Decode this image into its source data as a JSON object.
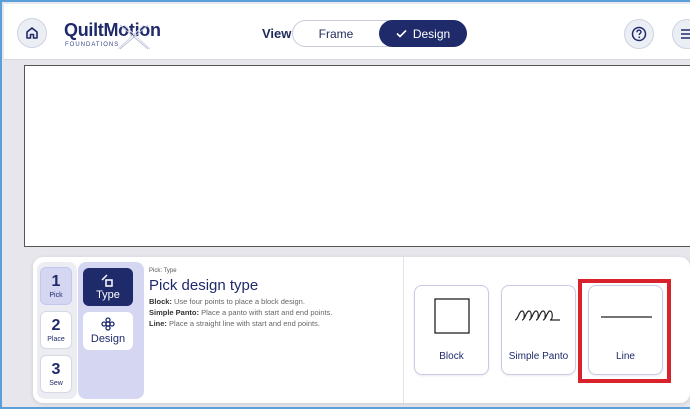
{
  "header": {
    "logo_main": "QuiltMotion",
    "logo_sub": "FOUNDATIONS",
    "view_label": "View",
    "view_options": {
      "frame": "Frame",
      "design": "Design"
    },
    "home_icon": "home-icon",
    "help_icon": "help-icon",
    "menu_icon": "hamburger-menu-icon"
  },
  "steps": [
    {
      "num": "1",
      "label": "Pick",
      "active": true
    },
    {
      "num": "2",
      "label": "Place",
      "active": false
    },
    {
      "num": "3",
      "label": "Sew",
      "active": false
    }
  ],
  "types": [
    {
      "label": "Type",
      "icon": "type-icon",
      "active": true
    },
    {
      "label": "Design",
      "icon": "design-icon",
      "active": false
    }
  ],
  "info": {
    "breadcrumb": "Pick: Type",
    "title": "Pick design type",
    "block_term": "Block:",
    "block_desc": "Use four points to place a block design.",
    "panto_term": "Simple Panto:",
    "panto_desc": "Place a panto with start and end points.",
    "line_term": "Line:",
    "line_desc": "Place a straight line with start and end points."
  },
  "design_types": [
    {
      "label": "Block",
      "icon": "square-icon"
    },
    {
      "label": "Simple Panto",
      "icon": "loops-icon"
    },
    {
      "label": "Line",
      "icon": "line-icon"
    }
  ],
  "colors": {
    "navy": "#1f2a6b",
    "lavender": "#d4d6f2",
    "highlight_red": "#d8222c",
    "frame_blue": "#5aa0d8"
  }
}
